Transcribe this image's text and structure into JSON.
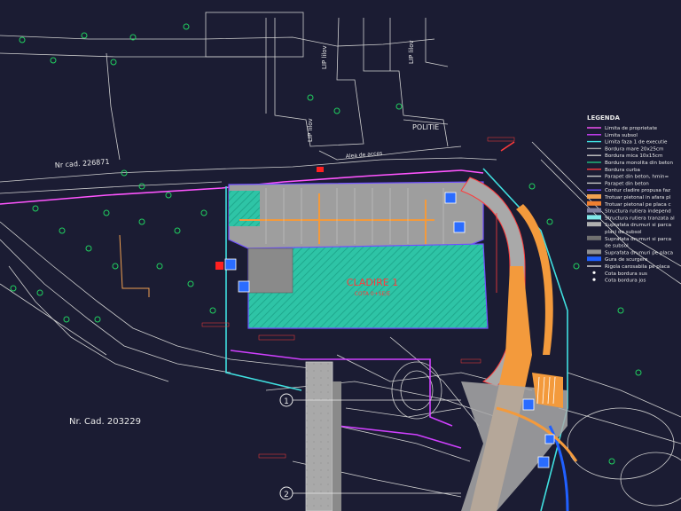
{
  "labels": {
    "cad_top": "Nr cad. 226871",
    "cad_bottom": "Nr. Cad. 203229",
    "politie": "POLITIE",
    "lip_1": "LIP lilov",
    "lip_2": "LIP lilov",
    "lip_3": "LIP lilov",
    "alea": "Alea de acces",
    "building_name": "CLADIRE 1",
    "building_sub": "COTA 0+SE/E",
    "marker_1": "1",
    "marker_2": "2"
  },
  "legend": {
    "title": "LEGENDA",
    "items": [
      {
        "text": "Limita de proprietate",
        "color": "#ff55ff",
        "style": "line"
      },
      {
        "text": "Limita subsol",
        "color": "#d040ff",
        "style": "line"
      },
      {
        "text": "Limita faza 1 de executie",
        "color": "#40e0e0",
        "style": "line"
      },
      {
        "text": "Bordura mare 20x25cm",
        "color": "#a0a0a0",
        "style": "line"
      },
      {
        "text": "Bordura mica 10x15cm",
        "color": "#c8c8c8",
        "style": "line"
      },
      {
        "text": "Bordura monolita din beton",
        "color": "#20c080",
        "style": "line"
      },
      {
        "text": "Bordura curba",
        "color": "#ff3b3b",
        "style": "line"
      },
      {
        "text": "Parapet din beton, hmin=",
        "color": "#c8c8c8",
        "style": "line"
      },
      {
        "text": "Parapet din beton",
        "color": "#c8c8c8",
        "style": "line"
      },
      {
        "text": "Contur cladire propusa faz",
        "color": "#7050ff",
        "style": "line"
      },
      {
        "text": "Trotuar pietonal in afara pl",
        "color": "#f0a050",
        "style": "fill"
      },
      {
        "text": "Trotuar pietonal pe placa c",
        "color": "#f08030",
        "style": "fill"
      },
      {
        "text": "Structura rutiera independ",
        "color": "#8080a0",
        "style": "fill"
      },
      {
        "text": "Structura rutiera tranzata al",
        "color": "#80e8e8",
        "style": "fill"
      },
      {
        "text": "Suprafata drumuri si parca",
        "color": "#b0b0b0",
        "style": "fill"
      },
      {
        "text": "placi de subsol",
        "color": "",
        "style": "none"
      },
      {
        "text": "Suprafata drumuri si parca",
        "color": "#707070",
        "style": "fill"
      },
      {
        "text": "de subsol",
        "color": "",
        "style": "none"
      },
      {
        "text": "Suprafata drumuri pe placa",
        "color": "#909090",
        "style": "fill"
      },
      {
        "text": "Gura de scurgere",
        "color": "#2060ff",
        "style": "fill"
      },
      {
        "text": "Rigola carosabila pe placa",
        "color": "#e0e0e0",
        "style": "line"
      },
      {
        "text": "Cota bordura sus",
        "color": "#ffffff",
        "style": "dot"
      },
      {
        "text": "Cota bordura jos",
        "color": "#ffffff",
        "style": "dot"
      }
    ]
  },
  "colors": {
    "background": "#1b1c33",
    "building_fill": "#2ec4a6",
    "property_line": "#ff55ff",
    "basement_line": "#d040ff",
    "phase_line": "#40e0e0",
    "road_fill": "#b9b9b9",
    "sidewalk": "#f39a3c",
    "linework": "#d8d8d8",
    "trees": "#20d060",
    "annotations": "#ff3b3b"
  }
}
